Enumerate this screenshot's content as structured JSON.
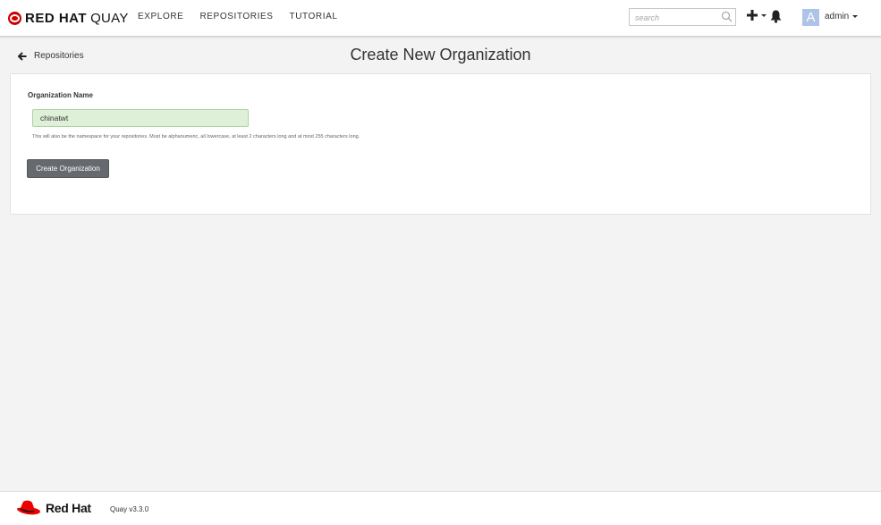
{
  "header": {
    "brand": "RED HAT",
    "brand_suffix": "QUAY",
    "nav": [
      "EXPLORE",
      "REPOSITORIES",
      "TUTORIAL"
    ],
    "search_placeholder": "search",
    "avatar_letter": "A",
    "username": "admin"
  },
  "breadcrumb": {
    "back_label": "Repositories"
  },
  "page": {
    "title": "Create New Organization",
    "field_label": "Organization Name",
    "field_value": "chinatwt",
    "help_text": "This will also be the namespace for your repositories. Must be alphanumeric, all lowercase, at least 2 characters long and at most 255 characters long.",
    "submit_label": "Create Organization"
  },
  "footer": {
    "brand": "Red Hat",
    "version": "Quay v3.3.0"
  },
  "colors": {
    "brand_red": "#cc0000",
    "input_valid_bg": "#dff0d8",
    "button_bg": "#666a6e",
    "avatar_bg": "#aec3e8"
  }
}
